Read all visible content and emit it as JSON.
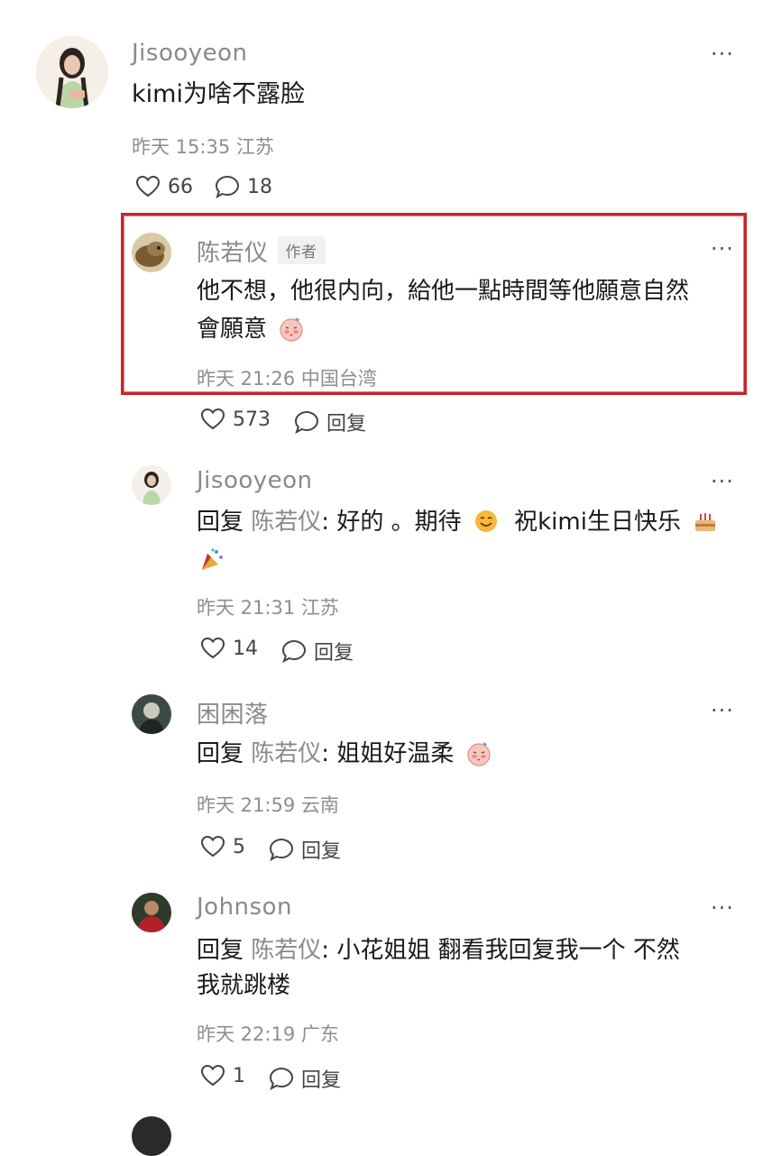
{
  "comment": {
    "user": "Jisooyeon",
    "text": "kimi为啥不露脸",
    "time": "昨天 15:35",
    "location": "江苏",
    "likes": "66",
    "replies": "18"
  },
  "reply_label": "回复",
  "author_tag": "作者",
  "replies": [
    {
      "user": "陈若仪",
      "line1": "他不想，他很内向，給他一點時間等他願意自然",
      "line2": "會願意",
      "time": "昨天 21:26",
      "location": "中国台湾",
      "likes": "573"
    },
    {
      "user": "Jisooyeon",
      "target": "陈若仪",
      "text_a": "好的 。期待",
      "text_b": "祝kimi生日快乐",
      "time": "昨天 21:31",
      "location": "江苏",
      "likes": "14"
    },
    {
      "user": "困困落",
      "target": "陈若仪",
      "text": "姐姐好温柔",
      "time": "昨天 21:59",
      "location": "云南",
      "likes": "5"
    },
    {
      "user": "Johnson",
      "target": "陈若仪",
      "line1": "小花姐姐 翻看我回复我一个 不然",
      "line2": "我就跳楼",
      "time": "昨天 22:19",
      "location": "广东",
      "likes": "1"
    }
  ],
  "icons": {
    "like": "heart-outline-icon",
    "comment": "speech-bubble-icon",
    "more": "more-dots-icon"
  },
  "colors": {
    "highlight_border": "#c8242b",
    "meta_text": "#8e8e8e"
  }
}
